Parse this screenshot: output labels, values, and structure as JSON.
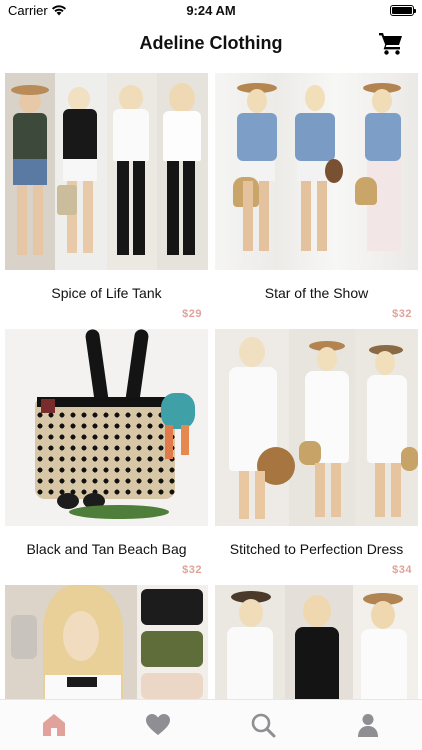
{
  "status_bar": {
    "carrier": "Carrier",
    "time": "9:24 AM"
  },
  "nav": {
    "title": "Adeline Clothing",
    "cart_icon": "cart-icon"
  },
  "products": [
    {
      "name": "Spice of Life Tank",
      "price": "$29"
    },
    {
      "name": "Star of the Show",
      "price": "$32"
    },
    {
      "name": "Black and Tan Beach Bag",
      "price": "$32"
    },
    {
      "name": "Stitched to Perfection Dress",
      "price": "$34"
    },
    {
      "name": "",
      "price": ""
    },
    {
      "name": "",
      "price": ""
    }
  ],
  "tab_bar": {
    "items": [
      {
        "icon": "home-icon",
        "selected": true
      },
      {
        "icon": "heart-icon",
        "selected": false
      },
      {
        "icon": "search-icon",
        "selected": false
      },
      {
        "icon": "profile-icon",
        "selected": false
      }
    ],
    "active_color": "#e0a29b",
    "inactive_color": "#8e8e93"
  }
}
